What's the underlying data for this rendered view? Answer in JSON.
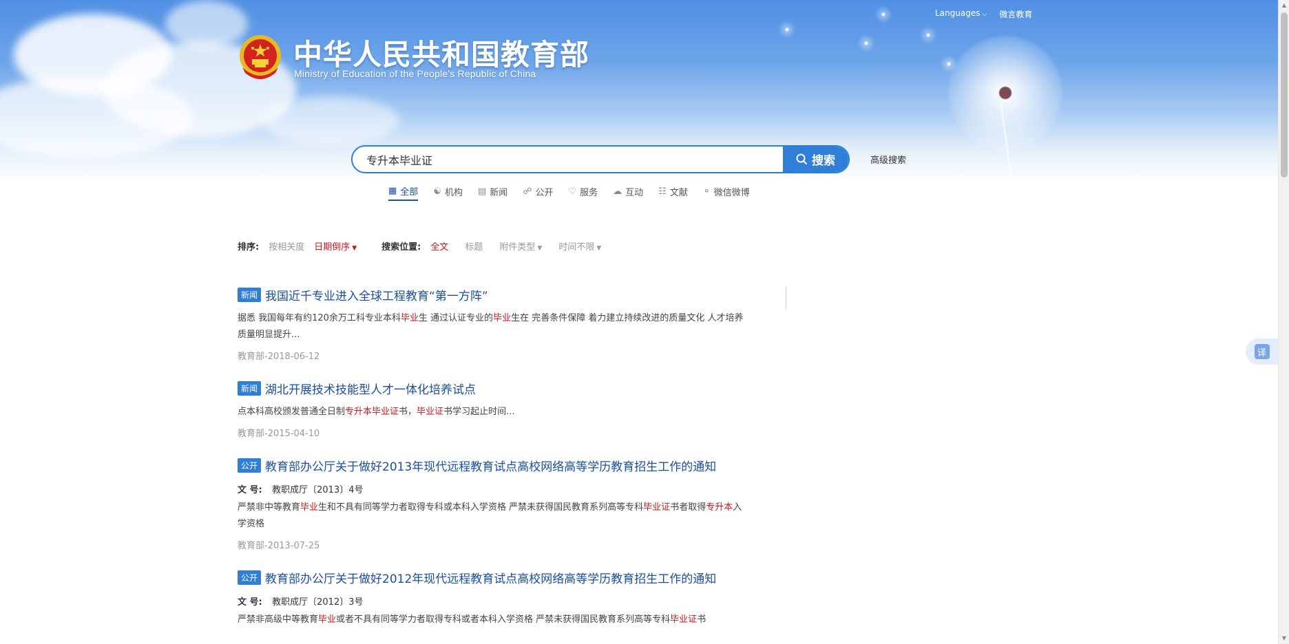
{
  "top_links": {
    "languages": "Languages",
    "weiyan": "微言教育"
  },
  "logo": {
    "cn": "中华人民共和国教育部",
    "en": "Ministry of Education of the People's Republic of China"
  },
  "search": {
    "query": "专升本毕业证",
    "button": "搜索",
    "advanced": "高级搜索"
  },
  "tabs": [
    {
      "label": "全部",
      "icon": "grid-icon",
      "active": true
    },
    {
      "label": "机构",
      "icon": "org-icon"
    },
    {
      "label": "新闻",
      "icon": "news-icon"
    },
    {
      "label": "公开",
      "icon": "lock-icon"
    },
    {
      "label": "服务",
      "icon": "heart-icon"
    },
    {
      "label": "互动",
      "icon": "chat-icon"
    },
    {
      "label": "文献",
      "icon": "document-icon"
    },
    {
      "label": "微信微博",
      "icon": "wechat-icon"
    }
  ],
  "sort": {
    "label": "排序:",
    "relevance": "按相关度",
    "date_desc": "日期倒序",
    "position_label": "搜索位置:",
    "fulltext": "全文",
    "title": "标题",
    "attachment": "附件类型",
    "time": "时间不限"
  },
  "results": [
    {
      "badge": "新闻",
      "title": "我国近千专业进入全球工程教育“第一方阵”",
      "snippet": [
        {
          "t": "据悉 我国每年有约120余万工科专业本科"
        },
        {
          "t": "毕业",
          "hl": true
        },
        {
          "t": "生 通过认证专业的"
        },
        {
          "t": "毕业",
          "hl": true
        },
        {
          "t": "生在 完善条件保障 着力建立持续改进的质量文化 人才培养质量明显提升..."
        }
      ],
      "source": "教育部-2018-06-12"
    },
    {
      "badge": "新闻",
      "title": "湖北开展技术技能型人才一体化培养试点",
      "snippet": [
        {
          "t": "点本科高校颁发普通全日制"
        },
        {
          "t": "专升本毕业证",
          "hl": true
        },
        {
          "t": "书，"
        },
        {
          "t": "毕业证",
          "hl": true
        },
        {
          "t": "书学习起止时间..."
        }
      ],
      "source": "教育部-2015-04-10"
    },
    {
      "badge": "公开",
      "title": "教育部办公厅关于做好2013年现代远程教育试点高校网络高等学历教育招生工作的通知",
      "meta_key": "文 号:",
      "meta_val": "教职成厅〔2013〕4号",
      "snippet": [
        {
          "t": "严禁非中等教育"
        },
        {
          "t": "毕业",
          "hl": true
        },
        {
          "t": "生和不具有同等学力者取得专科或本科入学资格 严禁未获得国民教育系列高等专科"
        },
        {
          "t": "毕业证",
          "hl": true
        },
        {
          "t": "书者取得"
        },
        {
          "t": "专升本",
          "hl": true
        },
        {
          "t": "入学资格"
        }
      ],
      "source": "教育部-2013-07-25"
    },
    {
      "badge": "公开",
      "title": "教育部办公厅关于做好2012年现代远程教育试点高校网络高等学历教育招生工作的通知",
      "meta_key": "文 号:",
      "meta_val": "教职成厅〔2012〕3号",
      "snippet": [
        {
          "t": "严禁非高级中等教育"
        },
        {
          "t": "毕业",
          "hl": true
        },
        {
          "t": "或者不具有同等学力者取得专科或者本科入学资格 严禁未获得国民教育系列高等专科"
        },
        {
          "t": "毕业证",
          "hl": true
        },
        {
          "t": "书"
        }
      ],
      "source": ""
    }
  ],
  "translate": "译",
  "colors": {
    "accent": "#2f7ed8",
    "highlight": "#c8151d",
    "link": "#1a4fa0"
  }
}
